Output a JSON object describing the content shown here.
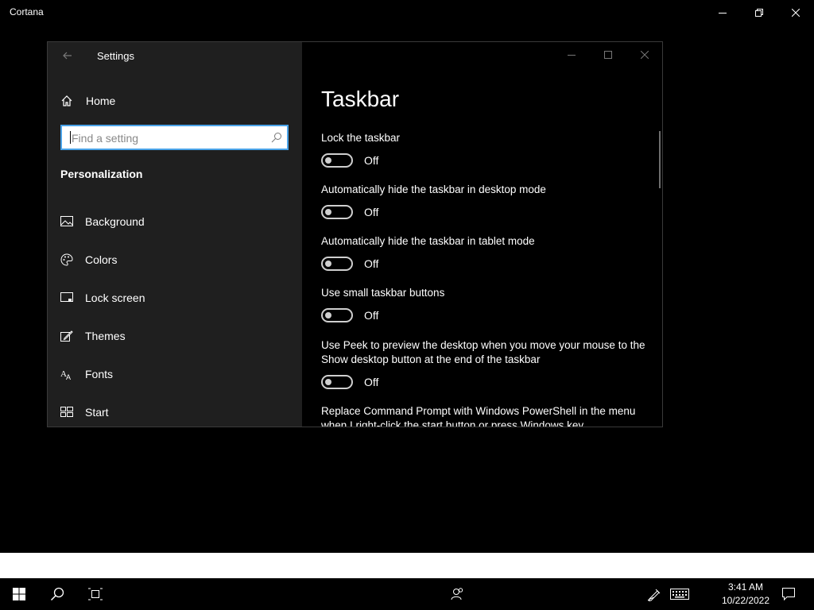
{
  "outer_window": {
    "title": "Cortana"
  },
  "settings_window": {
    "app_title": "Settings",
    "home_label": "Home",
    "search": {
      "placeholder": "Find a setting"
    },
    "section_title": "Personalization",
    "nav_items": [
      {
        "label": "Background",
        "icon": "image-icon"
      },
      {
        "label": "Colors",
        "icon": "palette-icon"
      },
      {
        "label": "Lock screen",
        "icon": "monitor-icon"
      },
      {
        "label": "Themes",
        "icon": "pencil-icon"
      },
      {
        "label": "Fonts",
        "icon": "fonts-icon"
      },
      {
        "label": "Start",
        "icon": "start-icon"
      }
    ]
  },
  "main": {
    "page_title": "Taskbar",
    "settings": [
      {
        "label": "Lock the taskbar",
        "state": "Off",
        "on": false
      },
      {
        "label": "Automatically hide the taskbar in desktop mode",
        "state": "Off",
        "on": false
      },
      {
        "label": "Automatically hide the taskbar in tablet mode",
        "state": "Off",
        "on": false
      },
      {
        "label": "Use small taskbar buttons",
        "state": "Off",
        "on": false
      },
      {
        "label": "Use Peek to preview the desktop when you move your mouse to the Show desktop button at the end of the taskbar",
        "state": "Off",
        "on": false
      },
      {
        "label": "Replace Command Prompt with Windows PowerShell in the menu when I right-click the start button or press Windows key"
      }
    ]
  },
  "taskbar": {
    "time": "3:41 AM",
    "date": "10/22/2022"
  },
  "colors": {
    "accent": "#4aa3e8",
    "sidebar_bg": "#1f1f1f",
    "main_bg": "#000000"
  }
}
